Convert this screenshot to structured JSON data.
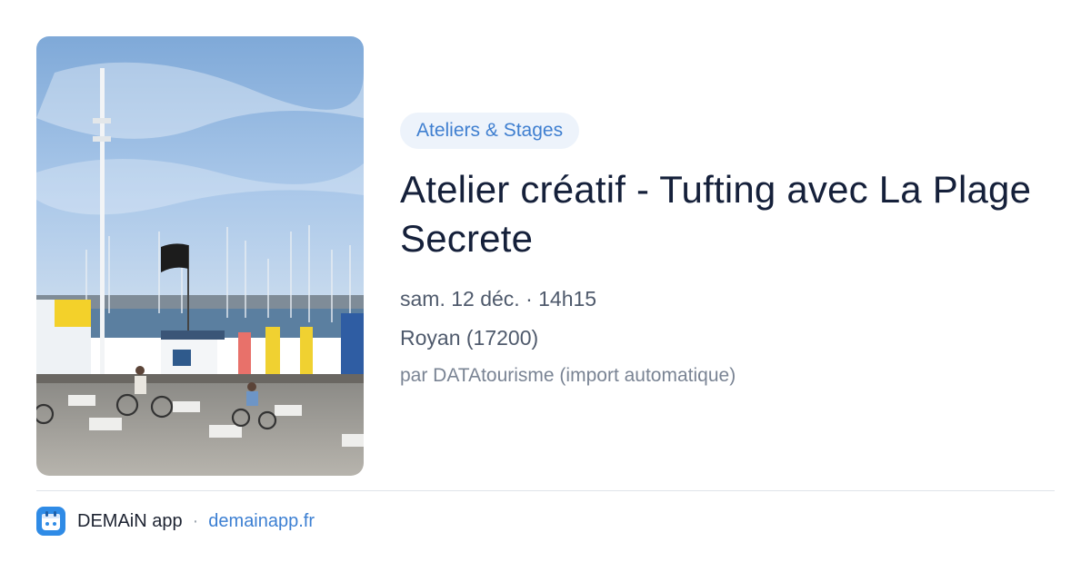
{
  "event": {
    "image": "harbor-photo",
    "category": "Ateliers & Stages",
    "title": "Atelier créatif - Tufting avec La Plage Secrete",
    "datetime": "sam. 12 déc. · 14h15",
    "location": "Royan (17200)",
    "source": "par DATAtourisme (import automatique)"
  },
  "footer": {
    "icon": "demain-app-icon",
    "app_name": "DEMAiN app",
    "separator": "·",
    "url": "demainapp.fr"
  },
  "colors": {
    "accent": "#3f7fd0",
    "badge_bg": "#edf3fb",
    "title": "#15203a",
    "muted": "#4f5a6c",
    "app_icon": "#2f8be6"
  }
}
